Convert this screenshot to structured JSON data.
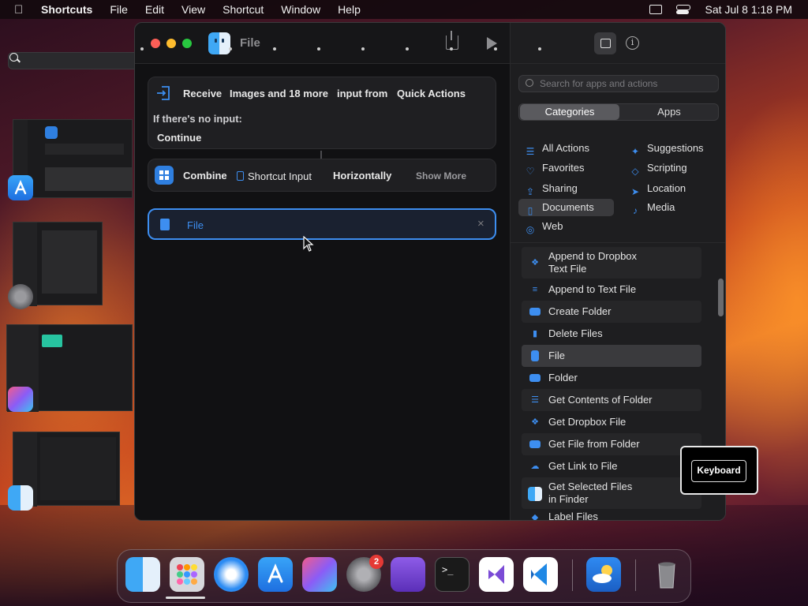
{
  "menubar": {
    "app": "Shortcuts",
    "items": [
      "File",
      "Edit",
      "View",
      "Shortcut",
      "Window",
      "Help"
    ],
    "clock": "Sat Jul 8  1:18 PM"
  },
  "window": {
    "title": "File"
  },
  "editor": {
    "receive": {
      "label": "Receive",
      "types": "Images and 18 more",
      "mid": "input from",
      "source": "Quick Actions",
      "no_input_label": "If there's no input:",
      "no_input_action": "Continue"
    },
    "combine": {
      "label": "Combine",
      "input": "Shortcut Input",
      "mode": "Horizontally",
      "show_more": "Show More"
    },
    "file_action": {
      "placeholder": "File",
      "close": "×"
    }
  },
  "sidebar": {
    "search_placeholder": "Search for apps and actions",
    "segments": [
      "Categories",
      "Apps"
    ],
    "categories_left": [
      "All Actions",
      "Favorites",
      "Sharing",
      "Documents",
      "Web"
    ],
    "categories_right": [
      "Suggestions",
      "Scripting",
      "Location",
      "Media"
    ],
    "actions": [
      "Append to Dropbox Text File",
      "Append to Text File",
      "Create Folder",
      "Delete Files",
      "File",
      "Folder",
      "Get Contents of Folder",
      "Get Dropbox File",
      "Get File from Folder",
      "Get Link to File",
      "Get Selected Files in Finder",
      "Label Files"
    ],
    "action_lines": {
      "a0l1": "Append to Dropbox",
      "a0l2": "Text File",
      "a10l1": "Get Selected Files",
      "a10l2": "in Finder"
    }
  },
  "keyboard_overlay": "Keyboard",
  "dock": {
    "badge_count": "2"
  }
}
